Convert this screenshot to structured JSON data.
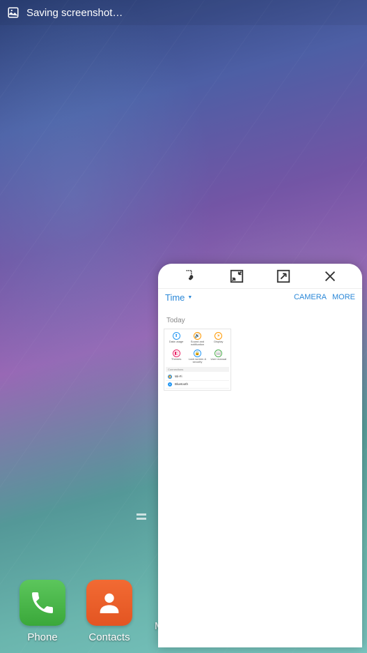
{
  "status": {
    "text": "Saving screenshot…"
  },
  "dock": {
    "phone": {
      "label": "Phone"
    },
    "contacts": {
      "label": "Contacts"
    },
    "cutoff": "M"
  },
  "popup": {
    "title": "Time",
    "actions": {
      "camera": "CAMERA",
      "more": "MORE"
    },
    "today": "Today",
    "thumbnail": {
      "row1": [
        {
          "label": "Data usage",
          "color": "c-blue"
        },
        {
          "label": "Sound and notification",
          "color": "c-orange"
        },
        {
          "label": "Display",
          "color": "c-orange"
        }
      ],
      "row2": [
        {
          "label": "Themes",
          "color": "c-pink"
        },
        {
          "label": "Lock screen & security",
          "color": "c-blue"
        },
        {
          "label": "User manual",
          "color": "c-green"
        }
      ],
      "section": "Connections",
      "list": [
        {
          "label": "Wi-Fi"
        },
        {
          "label": "Bluetooth"
        }
      ]
    }
  }
}
